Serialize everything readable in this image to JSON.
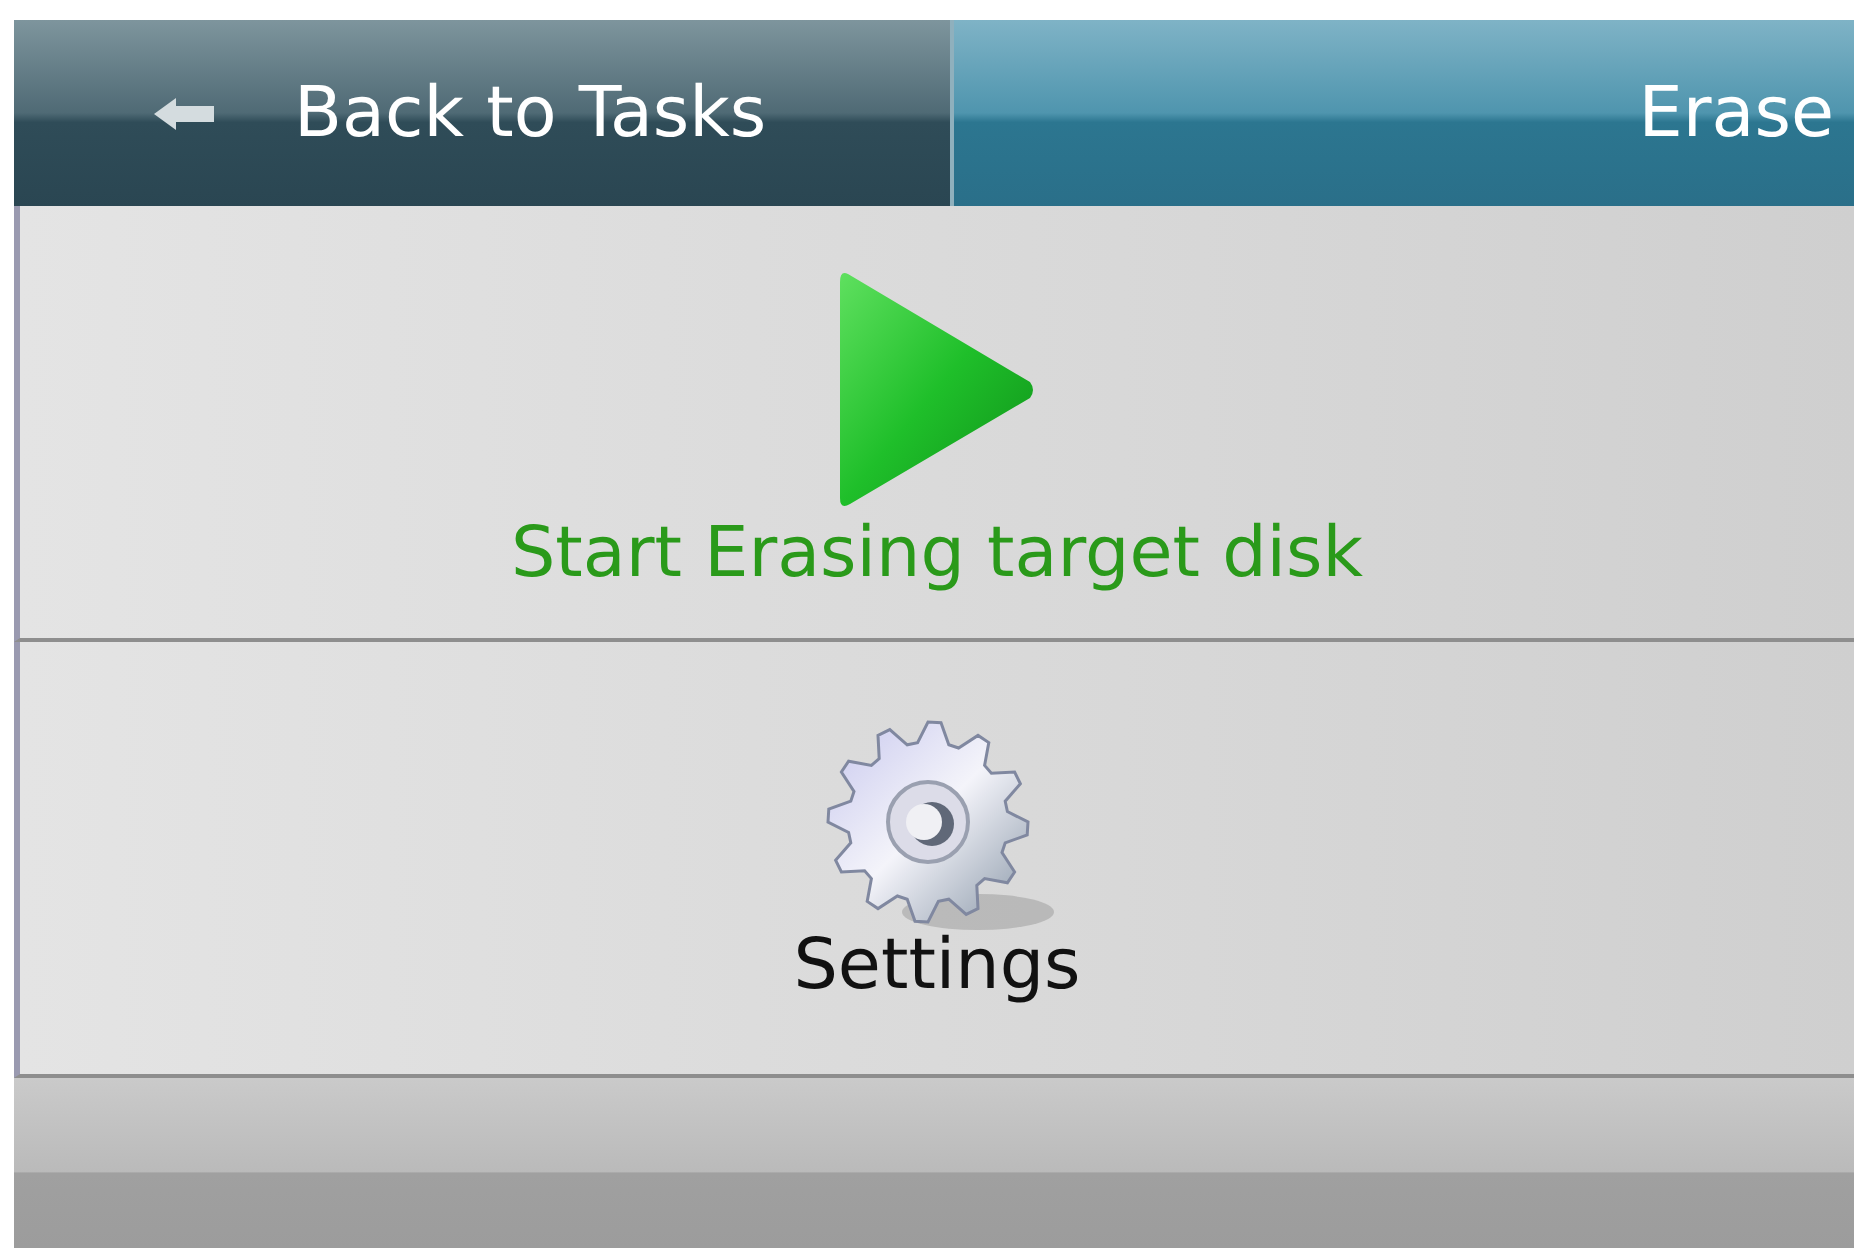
{
  "header": {
    "back_button": {
      "label": "Back to Tasks"
    },
    "title": "Erase"
  },
  "actions": [
    {
      "kind": "start",
      "label": "Start Erasing target disk"
    },
    {
      "kind": "settings",
      "label": "Settings"
    }
  ]
}
